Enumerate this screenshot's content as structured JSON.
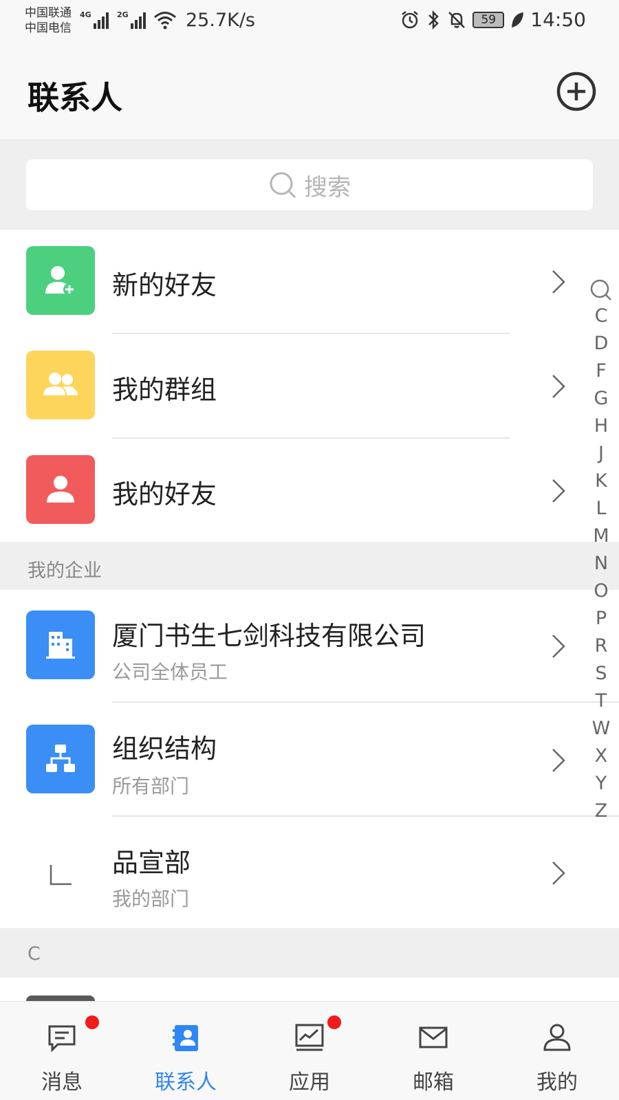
{
  "status_bar": {
    "carrier1": "中国联通",
    "carrier2": "中国电信",
    "net1": "4G",
    "net2": "2G",
    "speed": "25.7K/s",
    "battery": "59",
    "time": "14:50"
  },
  "header": {
    "title": "联系人",
    "add_icon": "plus-circle-icon"
  },
  "search": {
    "placeholder": "搜索",
    "icon": "search-icon"
  },
  "quick_items": [
    {
      "label": "新的好友",
      "icon": "user-add-icon",
      "color": "#4cd080"
    },
    {
      "label": "我的群组",
      "icon": "group-icon",
      "color": "#fdd55a"
    },
    {
      "label": "我的好友",
      "icon": "user-icon",
      "color": "#f25b5b"
    }
  ],
  "enterprise_section": {
    "title": "我的企业",
    "items": [
      {
        "label": "厦门书生七剑科技有限公司",
        "sublabel": "公司全体员工",
        "icon": "building-icon",
        "color": "#3a8ef6"
      },
      {
        "label": "组织结构",
        "sublabel": "所有部门",
        "icon": "org-chart-icon",
        "color": "#3a8ef6"
      },
      {
        "label": "品宣部",
        "sublabel": "我的部门",
        "icon": "tree-branch-icon"
      }
    ]
  },
  "c_section": {
    "title": "C"
  },
  "alpha_index": [
    "C",
    "D",
    "F",
    "G",
    "H",
    "J",
    "K",
    "L",
    "M",
    "N",
    "O",
    "P",
    "R",
    "S",
    "T",
    "W",
    "X",
    "Y",
    "Z"
  ],
  "bottom_nav": [
    {
      "label": "消息",
      "icon": "message-icon",
      "badge": true,
      "active": false
    },
    {
      "label": "联系人",
      "icon": "contacts-icon",
      "badge": false,
      "active": true
    },
    {
      "label": "应用",
      "icon": "chart-icon",
      "badge": true,
      "active": false
    },
    {
      "label": "邮箱",
      "icon": "mail-icon",
      "badge": false,
      "active": false
    },
    {
      "label": "我的",
      "icon": "profile-icon",
      "badge": false,
      "active": false
    }
  ],
  "colors": {
    "accent": "#2f86f6",
    "badge": "#f21a1a",
    "section_bg": "#efefef"
  }
}
